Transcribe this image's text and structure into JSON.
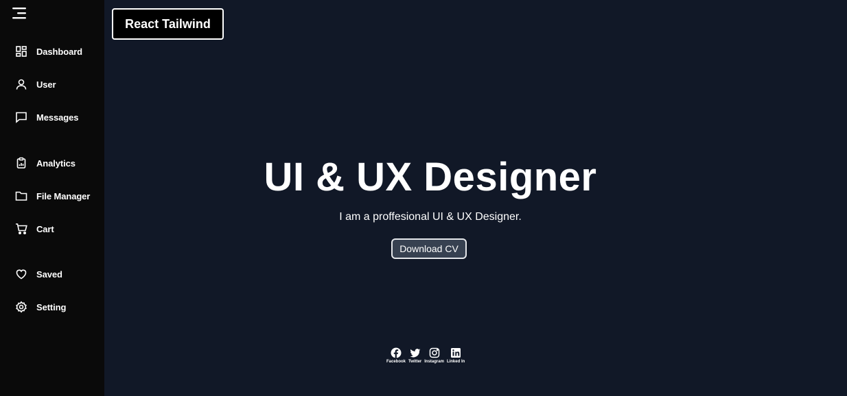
{
  "sidebar": {
    "items": [
      {
        "label": "Dashboard",
        "icon": "dashboard-icon"
      },
      {
        "label": "User",
        "icon": "user-icon"
      },
      {
        "label": "Messages",
        "icon": "message-icon"
      },
      {
        "label": "Analytics",
        "icon": "analytics-icon"
      },
      {
        "label": "File Manager",
        "icon": "folder-icon"
      },
      {
        "label": "Cart",
        "icon": "cart-icon"
      },
      {
        "label": "Saved",
        "icon": "heart-icon"
      },
      {
        "label": "Setting",
        "icon": "settings-icon"
      }
    ]
  },
  "header": {
    "brand": "React Tailwind"
  },
  "hero": {
    "title": "UI & UX Designer",
    "subtitle": "I am a proffesional UI & UX Designer.",
    "cta": "Download CV"
  },
  "socials": [
    {
      "label": "Facebook",
      "icon": "facebook-icon"
    },
    {
      "label": "Twitter",
      "icon": "twitter-icon"
    },
    {
      "label": "Instagram",
      "icon": "instagram-icon"
    },
    {
      "label": "Linked In",
      "icon": "linkedin-icon"
    }
  ],
  "colors": {
    "sidebar_bg": "#0a0a0a",
    "main_bg": "#111827",
    "button_bg": "#374151"
  }
}
